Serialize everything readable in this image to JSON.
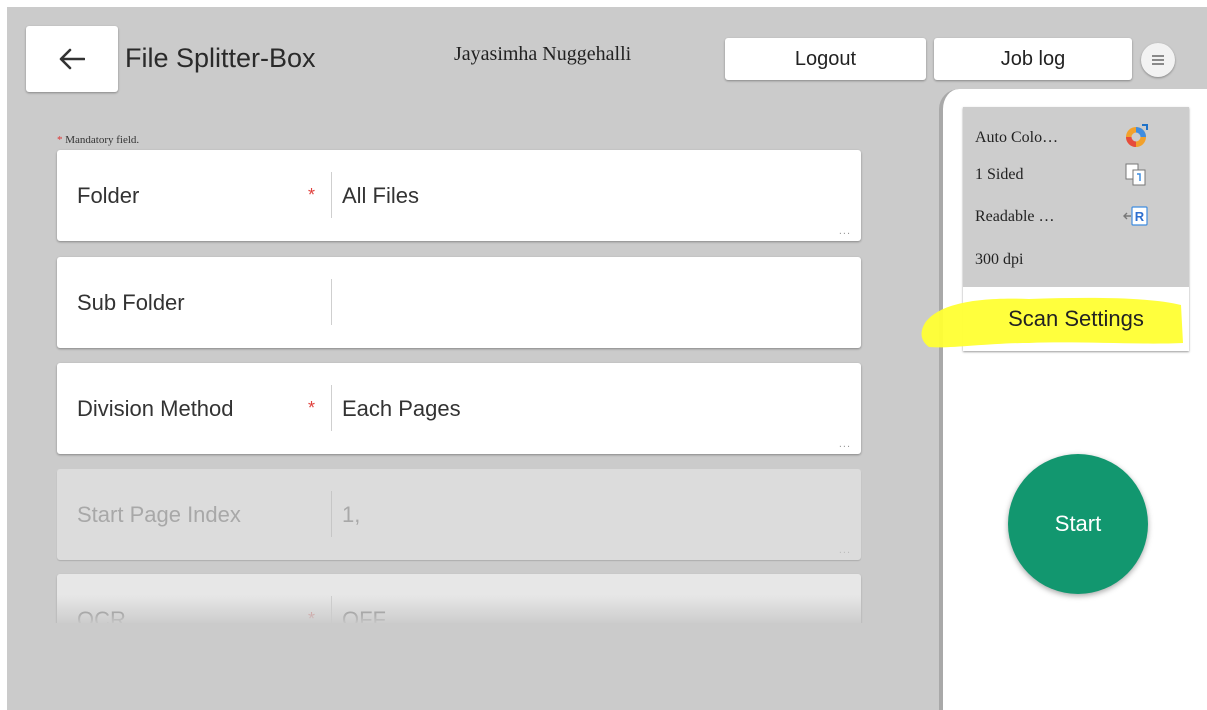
{
  "header": {
    "title": "File Splitter-Box",
    "user_name": "Jayasimha Nuggehalli",
    "logout_label": "Logout",
    "job_log_label": "Job log"
  },
  "form": {
    "mandatory_star": "*",
    "mandatory_note": "Mandatory field.",
    "fields": [
      {
        "label": "Folder",
        "required_mark": "*",
        "value": "All Files",
        "more": "..."
      },
      {
        "label": "Sub Folder",
        "required_mark": "",
        "value": "",
        "more": ""
      },
      {
        "label": "Division Method",
        "required_mark": "*",
        "value": "Each Pages",
        "more": "..."
      },
      {
        "label": "Start Page Index",
        "required_mark": "",
        "value": "1,",
        "more": "..."
      },
      {
        "label": "OCR",
        "required_mark": "*",
        "value": "OFF",
        "more": ""
      }
    ]
  },
  "scan": {
    "items": [
      {
        "text": "Auto Colo…",
        "icon": "auto-color-icon"
      },
      {
        "text": "1 Sided",
        "icon": "one-sided-icon"
      },
      {
        "text": "Readable …",
        "icon": "readable-direction-icon"
      },
      {
        "text": "300 dpi",
        "icon": ""
      }
    ],
    "settings_label": "Scan Settings",
    "highlight_color": "#ffff33"
  },
  "start_label": "Start",
  "colors": {
    "background": "#cbcbcb",
    "accent_start": "#12976f",
    "required": "#e0413d"
  }
}
